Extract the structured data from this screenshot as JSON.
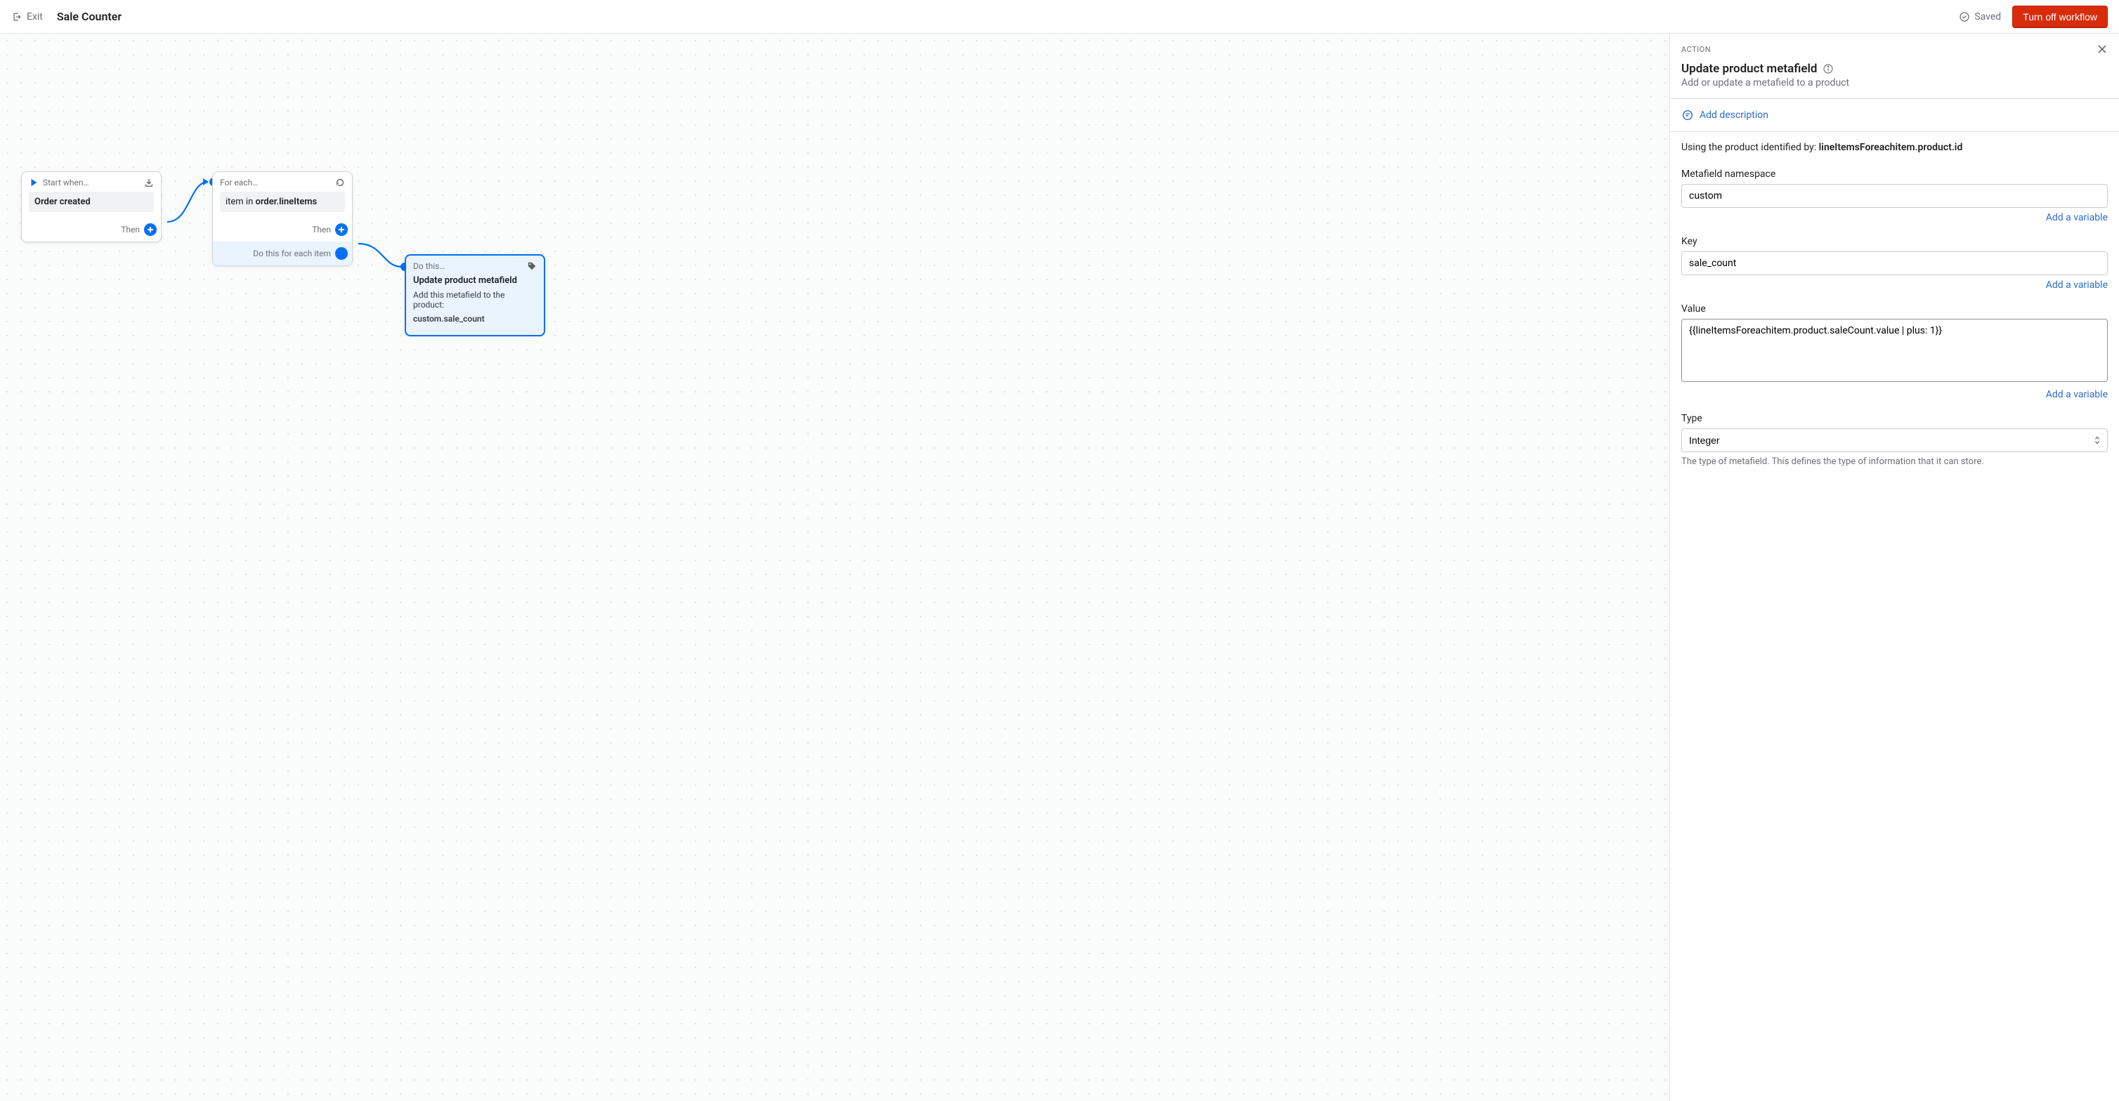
{
  "topbar": {
    "exit_label": "Exit",
    "workflow_title": "Sale Counter",
    "saved_label": "Saved",
    "turnoff_label": "Turn off workflow"
  },
  "canvas": {
    "nodes": {
      "trigger": {
        "head": "Start when…",
        "title": "Order created",
        "foot": "Then"
      },
      "foreach": {
        "head": "For each…",
        "prefix": "item in ",
        "path": "order.lineItems",
        "foot": "Then",
        "loop_foot": "Do this for each item"
      },
      "action": {
        "head": "Do this…",
        "title": "Update product metafield",
        "desc": "Add this metafield to the product:",
        "ref": "custom.sale_count"
      }
    }
  },
  "panel": {
    "section_label": "ACTION",
    "title": "Update product metafield",
    "subtitle": "Add or update a metafield to a product",
    "add_description": "Add description",
    "identified_prefix": "Using the product identified by: ",
    "identified_value": "lineItemsForeachitem.product.id",
    "fields": {
      "namespace_label": "Metafield namespace",
      "namespace_value": "custom",
      "key_label": "Key",
      "key_value": "sale_count",
      "value_label": "Value",
      "value_value": "{{lineItemsForeachitem.product.saleCount.value | plus: 1}}",
      "type_label": "Type",
      "type_value": "Integer",
      "type_helper": "The type of metafield. This defines the type of information that it can store."
    },
    "add_variable": "Add a variable"
  }
}
